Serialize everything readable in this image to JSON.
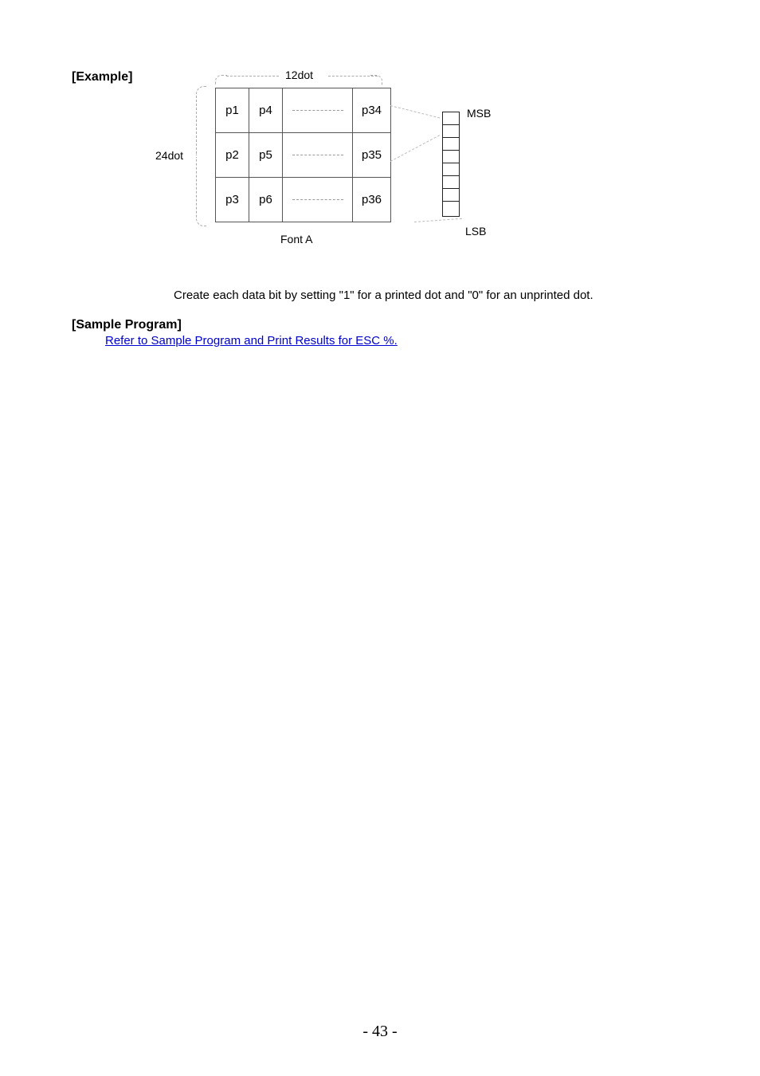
{
  "headings": {
    "example": "[Example]",
    "sample_program": "[Sample Program]"
  },
  "diagram": {
    "top_label": "12dot",
    "left_label": "24dot",
    "bottom_label": "Font A",
    "msb": "MSB",
    "lsb": "LSB",
    "cells": {
      "r0c0": "p1",
      "r0c1": "p4",
      "r0c3": "p34",
      "r1c0": "p2",
      "r1c1": "p5",
      "r1c3": "p35",
      "r2c0": "p3",
      "r2c1": "p6",
      "r2c3": "p36"
    }
  },
  "caption": "Create each data bit by setting \"1\" for a printed dot and \"0\" for an unprinted dot.",
  "link_text": "Refer to Sample Program and Print Results for ESC %.",
  "page_number": "- 43 -"
}
